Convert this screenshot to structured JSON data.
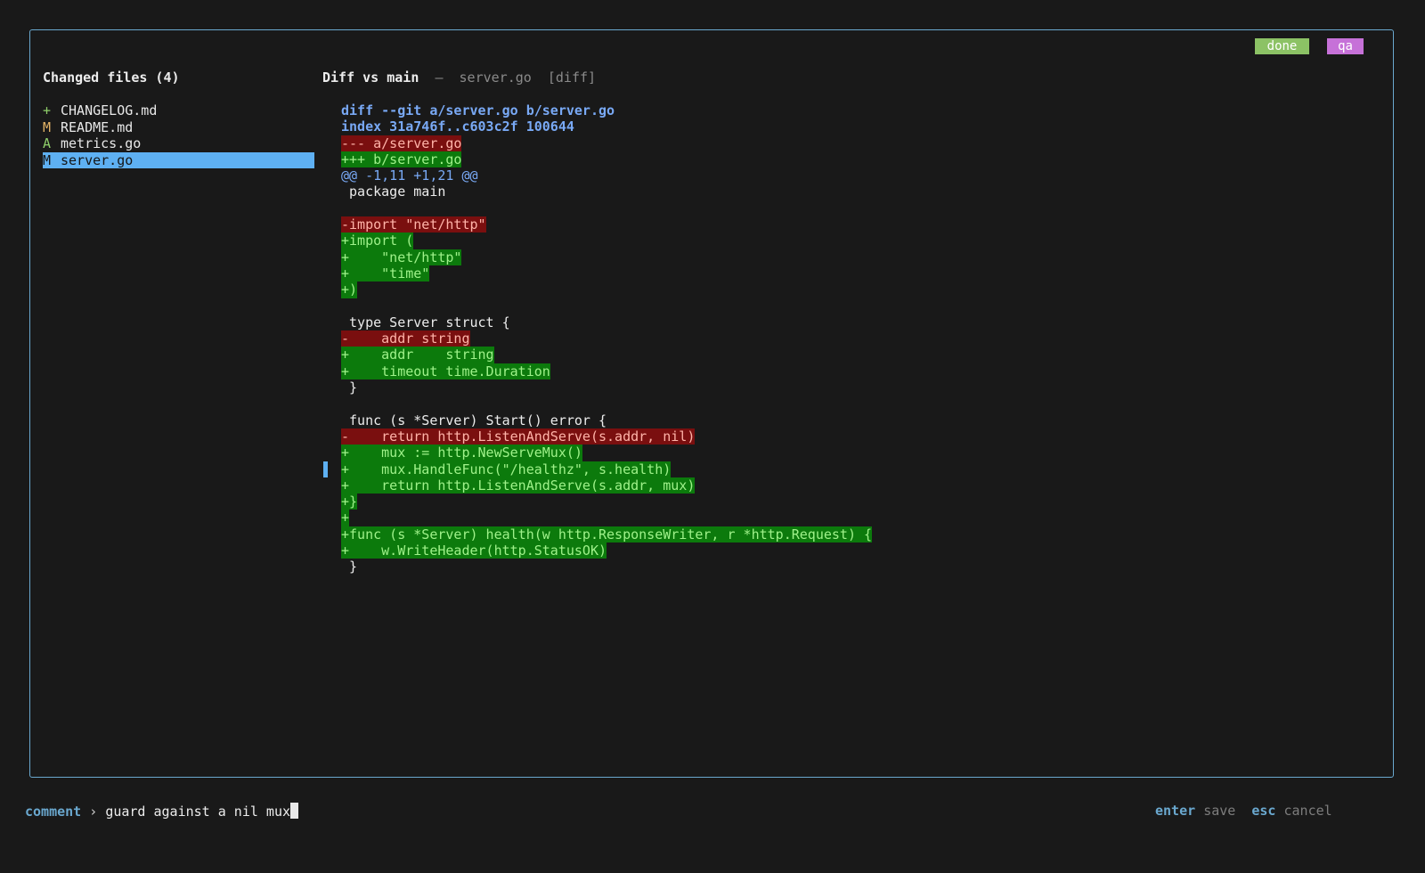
{
  "badges": {
    "done": "done",
    "qa": "qa"
  },
  "files_panel": {
    "title": "Changed files (4)",
    "items": [
      {
        "status": "+",
        "name": "CHANGELOG.md"
      },
      {
        "status": "M",
        "name": "README.md"
      },
      {
        "status": "A",
        "name": "metrics.go"
      },
      {
        "status": "M",
        "name": "server.go",
        "selected": true
      }
    ]
  },
  "diff_panel": {
    "title": "Diff vs main",
    "separator": "—",
    "filename": "server.go",
    "tag": "[diff]",
    "lines": [
      {
        "kind": "meta",
        "text": "diff --git a/server.go b/server.go"
      },
      {
        "kind": "meta",
        "text": "index 31a746f..c603c2f 100644"
      },
      {
        "kind": "hdrdel",
        "text": "--- a/server.go"
      },
      {
        "kind": "hdradd",
        "text": "+++ b/server.go"
      },
      {
        "kind": "hunk",
        "text": "@@ -1,11 +1,21 @@"
      },
      {
        "kind": "ctx",
        "text": " package main"
      },
      {
        "kind": "empty",
        "text": ""
      },
      {
        "kind": "del",
        "text": "-import \"net/http\""
      },
      {
        "kind": "add",
        "text": "+import ("
      },
      {
        "kind": "add",
        "text": "+    \"net/http\""
      },
      {
        "kind": "add",
        "text": "+    \"time\""
      },
      {
        "kind": "add",
        "text": "+)"
      },
      {
        "kind": "empty",
        "text": ""
      },
      {
        "kind": "ctx",
        "text": " type Server struct {"
      },
      {
        "kind": "del",
        "text": "-    addr string"
      },
      {
        "kind": "add",
        "text": "+    addr    string"
      },
      {
        "kind": "add",
        "text": "+    timeout time.Duration"
      },
      {
        "kind": "ctx",
        "text": " }"
      },
      {
        "kind": "empty",
        "text": ""
      },
      {
        "kind": "ctx",
        "text": " func (s *Server) Start() error {"
      },
      {
        "kind": "del",
        "text": "-    return http.ListenAndServe(s.addr, nil)"
      },
      {
        "kind": "add",
        "text": "+    mux := http.NewServeMux()"
      },
      {
        "kind": "add",
        "text": "+    mux.HandleFunc(\"/healthz\", s.health)"
      },
      {
        "kind": "add",
        "text": "+    return http.ListenAndServe(s.addr, mux)"
      },
      {
        "kind": "add",
        "text": "+}"
      },
      {
        "kind": "add",
        "text": "+"
      },
      {
        "kind": "add",
        "text": "+func (s *Server) health(w http.ResponseWriter, r *http.Request) {"
      },
      {
        "kind": "add",
        "text": "+    w.WriteHeader(http.StatusOK)"
      },
      {
        "kind": "ctx",
        "text": " }"
      }
    ]
  },
  "comment_bar": {
    "label": "comment",
    "arrow": "›",
    "value": "guard against a nil mux"
  },
  "hints": {
    "enter_key": "enter",
    "enter_action": "save",
    "esc_key": "esc",
    "esc_action": "cancel"
  },
  "colors": {
    "frame_border": "#6aa8cf",
    "selection": "#5eb0f2",
    "added_bg": "#0c7a0c",
    "removed_bg": "#7a0f0f",
    "badge_done": "#8cc265",
    "badge_qa": "#c671d8"
  }
}
